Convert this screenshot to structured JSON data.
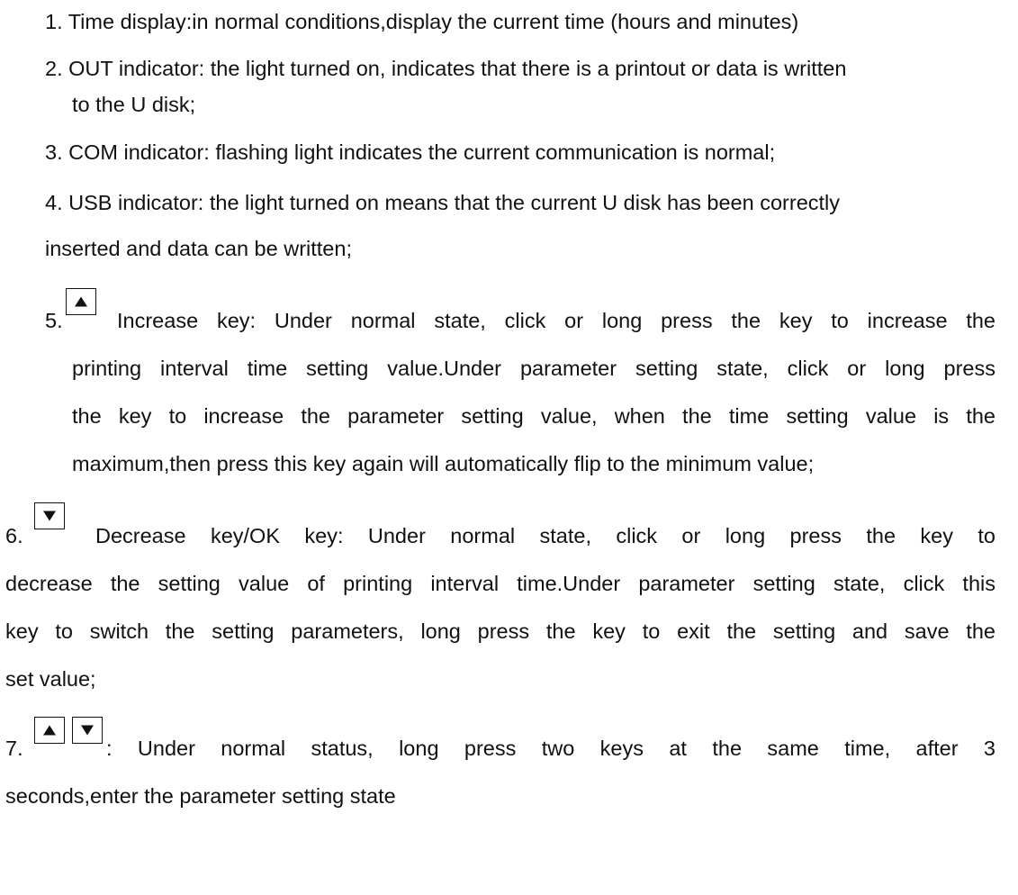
{
  "items": {
    "i1": {
      "text": "1. Time display:in normal conditions,display the current time (hours and minutes)"
    },
    "i2": {
      "line1": "2.  OUT indicator: the light turned on, indicates that there is a printout or data is written",
      "line2": "to the U disk;"
    },
    "i3": {
      "text": "3. COM indicator: flashing light indicates the current communication is normal;"
    },
    "i4": {
      "line1": "4. USB indicator: the light turned on means that the current U disk has been correctly",
      "line2": "inserted and data can be written;"
    },
    "i5": {
      "number": "5.",
      "line1": "Increase key: Under normal state, click or long press the key to increase the",
      "line2": "printing interval time setting value.Under parameter setting state, click or long press",
      "line3": "the key to increase the parameter setting value, when the time setting value is the",
      "line4": "maximum,then press this key again will automatically flip to the minimum value;"
    },
    "i6": {
      "number": "6.",
      "line1": "Decrease key/OK key: Under normal state, click or long press the key to",
      "line2": "decrease the setting value of printing interval time.Under parameter setting state, click this",
      "line3": "key to switch the setting parameters, long press the key to exit the setting and save the",
      "line4": "set value;"
    },
    "i7": {
      "number": "7.",
      "line1": ": Under normal status, long press two keys at the same time, after 3",
      "line2": "seconds,enter the parameter setting state"
    }
  },
  "icons": {
    "up": "up-arrow-key-icon",
    "down": "down-arrow-key-icon"
  },
  "colors": {
    "text": "#111111",
    "background": "#ffffff"
  }
}
